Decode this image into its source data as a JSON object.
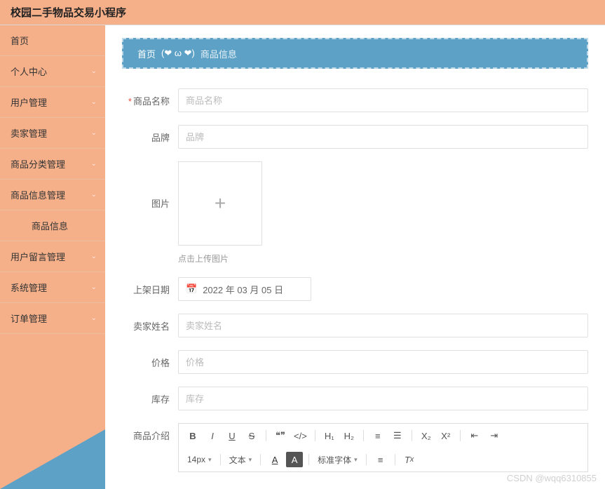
{
  "header": {
    "title": "校园二手物品交易小程序"
  },
  "sidebar": {
    "items": [
      {
        "label": "首页",
        "expandable": false
      },
      {
        "label": "个人中心",
        "expandable": true
      },
      {
        "label": "用户管理",
        "expandable": true
      },
      {
        "label": "卖家管理",
        "expandable": true
      },
      {
        "label": "商品分类管理",
        "expandable": true
      },
      {
        "label": "商品信息管理",
        "expandable": true
      },
      {
        "label": "商品信息",
        "sub": true
      },
      {
        "label": "用户留言管理",
        "expandable": true
      },
      {
        "label": "系统管理",
        "expandable": true
      },
      {
        "label": "订单管理",
        "expandable": true
      }
    ]
  },
  "breadcrumb": {
    "home": "首页",
    "emoji": "(❤ ω ❤)",
    "current": "商品信息"
  },
  "form": {
    "name": {
      "label": "商品名称",
      "placeholder": "商品名称",
      "required": true
    },
    "brand": {
      "label": "品牌",
      "placeholder": "品牌"
    },
    "image": {
      "label": "图片",
      "hint": "点击上传图片"
    },
    "date": {
      "label": "上架日期",
      "value": "2022 年 03 月 05 日"
    },
    "seller": {
      "label": "卖家姓名",
      "placeholder": "卖家姓名"
    },
    "price": {
      "label": "价格",
      "placeholder": "价格"
    },
    "stock": {
      "label": "库存",
      "placeholder": "库存"
    },
    "intro": {
      "label": "商品介绍"
    }
  },
  "editor": {
    "fontSize": "14px",
    "textLabel": "文本",
    "fontLabel": "标准字体",
    "h1": "H₁",
    "h2": "H₂"
  },
  "watermark": "CSDN @wqq6310855"
}
